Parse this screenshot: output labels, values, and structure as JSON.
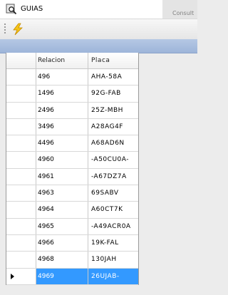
{
  "window": {
    "title": "GUIAS"
  },
  "background_window": {
    "partial_text": "Consult"
  },
  "toolbar": {
    "action_icon": "lightning-bolt-icon"
  },
  "grid": {
    "columns": [
      "Relacion",
      "Placa"
    ],
    "rows": [
      [
        "496",
        "AHA-58A"
      ],
      [
        "1496",
        "92G-FAB"
      ],
      [
        "2496",
        "25Z-MBH"
      ],
      [
        "3496",
        "A28AG4F"
      ],
      [
        "4496",
        "A68AD6N"
      ],
      [
        "4960",
        "-A50CU0A-"
      ],
      [
        "4961",
        "-A67DZ7A"
      ],
      [
        "4963",
        "69SABV"
      ],
      [
        "4964",
        "A60CT7K"
      ],
      [
        "4965",
        "-A49ACR0A"
      ],
      [
        "4966",
        "19K-FAL"
      ],
      [
        "4968",
        "130JAH"
      ],
      [
        "4969",
        "26UJAB-"
      ]
    ],
    "selected_index": 12
  },
  "colors": {
    "selection": "#3399ff",
    "band": "#a9bfe0"
  }
}
